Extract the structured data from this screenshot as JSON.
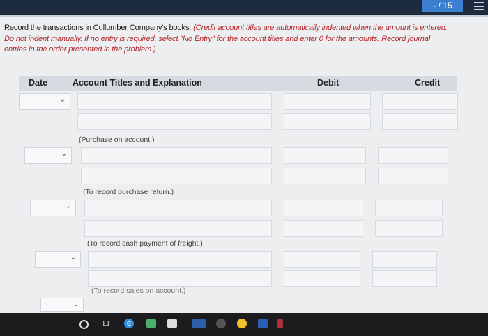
{
  "header": {
    "counter": "- / 15",
    "menu_icon": "hamburger-menu-icon"
  },
  "instructions": {
    "text": "Record the transactions in Cullumber Company's books. ",
    "note": "(Credit account titles are automatically indented when the amount is entered. Do not indent manually. If no entry is required, select \"No Entry\" for the account titles and enter 0 for the amounts. Record journal entries in the order presented in the problem.)"
  },
  "table": {
    "headers": {
      "date": "Date",
      "account": "Account Titles and Explanation",
      "debit": "Debit",
      "credit": "Credit"
    },
    "entries": [
      {
        "note": "(Purchase on account.)"
      },
      {
        "note": "(To record purchase return.)"
      },
      {
        "note": "(To record cash payment of freight.)"
      },
      {
        "note": "(To record sales on account.)"
      }
    ]
  },
  "taskbar": {
    "icons": [
      "start-circle-icon",
      "task-view-icon",
      "edge-icon",
      "store-icon",
      "lock-icon",
      "photos-icon",
      "chrome-icon",
      "chat-icon",
      "word-icon",
      "app-icon"
    ],
    "accent_colors": {
      "edge": "#2f8ee0",
      "store": "#4caf6a",
      "chrome": "#f2c02e",
      "word": "#2b5fb3"
    }
  }
}
